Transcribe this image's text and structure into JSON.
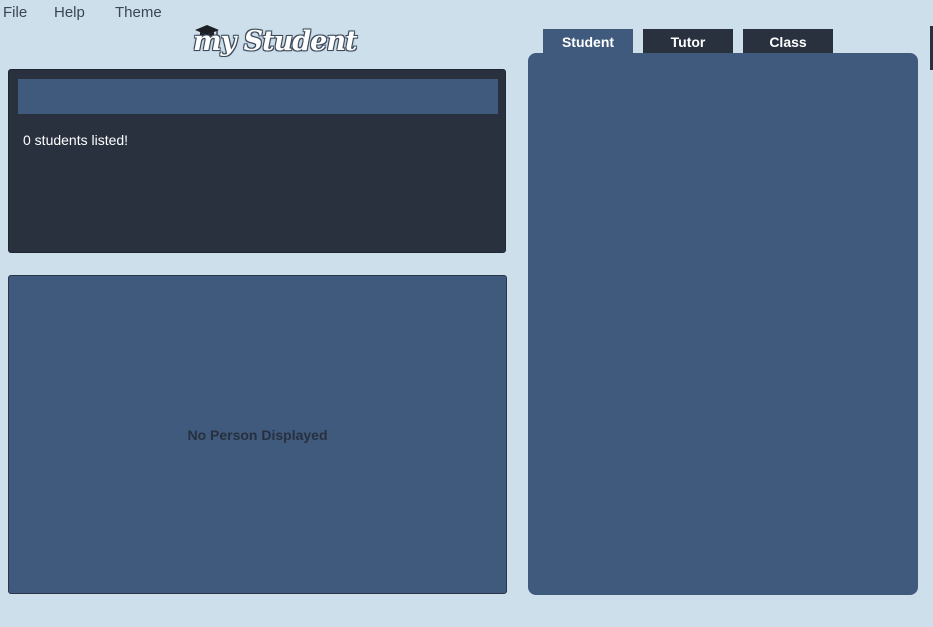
{
  "menu": {
    "file": "File",
    "help": "Help",
    "theme": "Theme"
  },
  "logo": {
    "text": "mStudent",
    "icon": "graduation-cap-icon"
  },
  "student_list": {
    "search_placeholder": "",
    "status": "0 students listed!"
  },
  "detail": {
    "empty_text": "No Person Displayed"
  },
  "tabs": [
    {
      "label": "Student",
      "active": true
    },
    {
      "label": "Tutor",
      "active": false
    },
    {
      "label": "Class",
      "active": false
    }
  ],
  "colors": {
    "background": "#cddfea",
    "panel_dark": "#29313f",
    "panel_blue": "#405a7e"
  }
}
